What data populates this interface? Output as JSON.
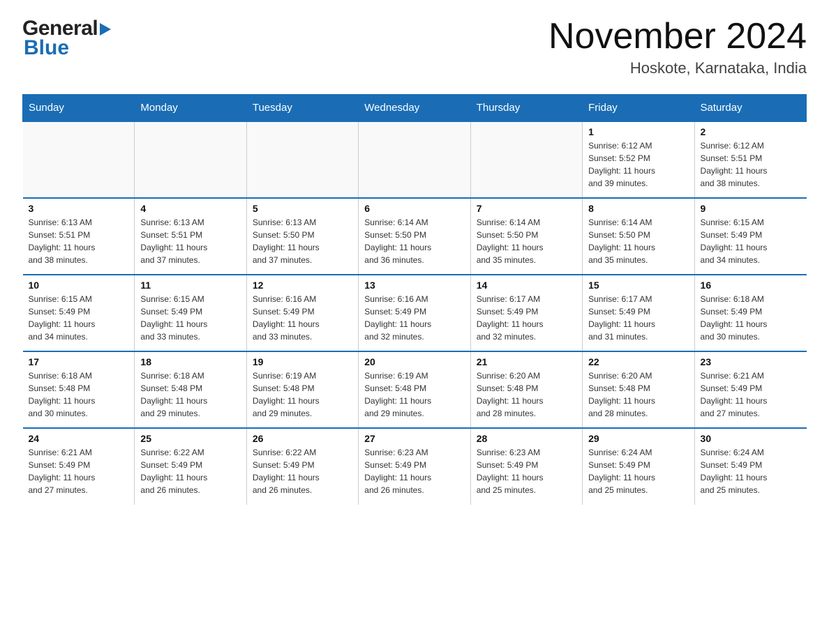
{
  "header": {
    "logo_general": "General",
    "logo_blue": "Blue",
    "month_title": "November 2024",
    "location": "Hoskote, Karnataka, India"
  },
  "weekdays": [
    "Sunday",
    "Monday",
    "Tuesday",
    "Wednesday",
    "Thursday",
    "Friday",
    "Saturday"
  ],
  "rows": [
    [
      {
        "day": "",
        "info": ""
      },
      {
        "day": "",
        "info": ""
      },
      {
        "day": "",
        "info": ""
      },
      {
        "day": "",
        "info": ""
      },
      {
        "day": "",
        "info": ""
      },
      {
        "day": "1",
        "info": "Sunrise: 6:12 AM\nSunset: 5:52 PM\nDaylight: 11 hours\nand 39 minutes."
      },
      {
        "day": "2",
        "info": "Sunrise: 6:12 AM\nSunset: 5:51 PM\nDaylight: 11 hours\nand 38 minutes."
      }
    ],
    [
      {
        "day": "3",
        "info": "Sunrise: 6:13 AM\nSunset: 5:51 PM\nDaylight: 11 hours\nand 38 minutes."
      },
      {
        "day": "4",
        "info": "Sunrise: 6:13 AM\nSunset: 5:51 PM\nDaylight: 11 hours\nand 37 minutes."
      },
      {
        "day": "5",
        "info": "Sunrise: 6:13 AM\nSunset: 5:50 PM\nDaylight: 11 hours\nand 37 minutes."
      },
      {
        "day": "6",
        "info": "Sunrise: 6:14 AM\nSunset: 5:50 PM\nDaylight: 11 hours\nand 36 minutes."
      },
      {
        "day": "7",
        "info": "Sunrise: 6:14 AM\nSunset: 5:50 PM\nDaylight: 11 hours\nand 35 minutes."
      },
      {
        "day": "8",
        "info": "Sunrise: 6:14 AM\nSunset: 5:50 PM\nDaylight: 11 hours\nand 35 minutes."
      },
      {
        "day": "9",
        "info": "Sunrise: 6:15 AM\nSunset: 5:49 PM\nDaylight: 11 hours\nand 34 minutes."
      }
    ],
    [
      {
        "day": "10",
        "info": "Sunrise: 6:15 AM\nSunset: 5:49 PM\nDaylight: 11 hours\nand 34 minutes."
      },
      {
        "day": "11",
        "info": "Sunrise: 6:15 AM\nSunset: 5:49 PM\nDaylight: 11 hours\nand 33 minutes."
      },
      {
        "day": "12",
        "info": "Sunrise: 6:16 AM\nSunset: 5:49 PM\nDaylight: 11 hours\nand 33 minutes."
      },
      {
        "day": "13",
        "info": "Sunrise: 6:16 AM\nSunset: 5:49 PM\nDaylight: 11 hours\nand 32 minutes."
      },
      {
        "day": "14",
        "info": "Sunrise: 6:17 AM\nSunset: 5:49 PM\nDaylight: 11 hours\nand 32 minutes."
      },
      {
        "day": "15",
        "info": "Sunrise: 6:17 AM\nSunset: 5:49 PM\nDaylight: 11 hours\nand 31 minutes."
      },
      {
        "day": "16",
        "info": "Sunrise: 6:18 AM\nSunset: 5:49 PM\nDaylight: 11 hours\nand 30 minutes."
      }
    ],
    [
      {
        "day": "17",
        "info": "Sunrise: 6:18 AM\nSunset: 5:48 PM\nDaylight: 11 hours\nand 30 minutes."
      },
      {
        "day": "18",
        "info": "Sunrise: 6:18 AM\nSunset: 5:48 PM\nDaylight: 11 hours\nand 29 minutes."
      },
      {
        "day": "19",
        "info": "Sunrise: 6:19 AM\nSunset: 5:48 PM\nDaylight: 11 hours\nand 29 minutes."
      },
      {
        "day": "20",
        "info": "Sunrise: 6:19 AM\nSunset: 5:48 PM\nDaylight: 11 hours\nand 29 minutes."
      },
      {
        "day": "21",
        "info": "Sunrise: 6:20 AM\nSunset: 5:48 PM\nDaylight: 11 hours\nand 28 minutes."
      },
      {
        "day": "22",
        "info": "Sunrise: 6:20 AM\nSunset: 5:48 PM\nDaylight: 11 hours\nand 28 minutes."
      },
      {
        "day": "23",
        "info": "Sunrise: 6:21 AM\nSunset: 5:49 PM\nDaylight: 11 hours\nand 27 minutes."
      }
    ],
    [
      {
        "day": "24",
        "info": "Sunrise: 6:21 AM\nSunset: 5:49 PM\nDaylight: 11 hours\nand 27 minutes."
      },
      {
        "day": "25",
        "info": "Sunrise: 6:22 AM\nSunset: 5:49 PM\nDaylight: 11 hours\nand 26 minutes."
      },
      {
        "day": "26",
        "info": "Sunrise: 6:22 AM\nSunset: 5:49 PM\nDaylight: 11 hours\nand 26 minutes."
      },
      {
        "day": "27",
        "info": "Sunrise: 6:23 AM\nSunset: 5:49 PM\nDaylight: 11 hours\nand 26 minutes."
      },
      {
        "day": "28",
        "info": "Sunrise: 6:23 AM\nSunset: 5:49 PM\nDaylight: 11 hours\nand 25 minutes."
      },
      {
        "day": "29",
        "info": "Sunrise: 6:24 AM\nSunset: 5:49 PM\nDaylight: 11 hours\nand 25 minutes."
      },
      {
        "day": "30",
        "info": "Sunrise: 6:24 AM\nSunset: 5:49 PM\nDaylight: 11 hours\nand 25 minutes."
      }
    ]
  ]
}
